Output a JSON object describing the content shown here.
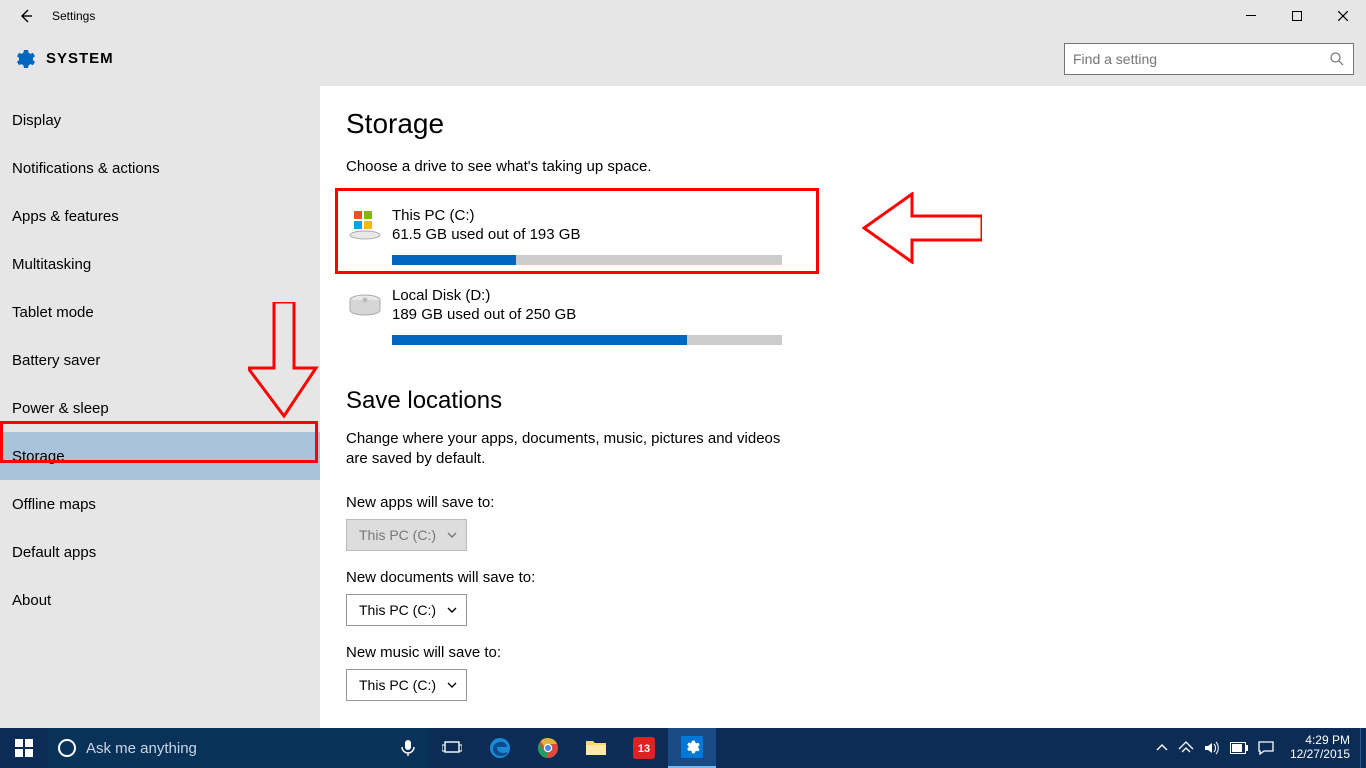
{
  "window": {
    "title": "Settings"
  },
  "header": {
    "section": "SYSTEM",
    "search_placeholder": "Find a setting"
  },
  "sidebar": {
    "items": [
      {
        "label": "Display"
      },
      {
        "label": "Notifications & actions"
      },
      {
        "label": "Apps & features"
      },
      {
        "label": "Multitasking"
      },
      {
        "label": "Tablet mode"
      },
      {
        "label": "Battery saver"
      },
      {
        "label": "Power & sleep"
      },
      {
        "label": "Storage"
      },
      {
        "label": "Offline maps"
      },
      {
        "label": "Default apps"
      },
      {
        "label": "About"
      }
    ],
    "selected_index": 7
  },
  "page": {
    "title": "Storage",
    "subtitle": "Choose a drive to see what's taking up space.",
    "drives": [
      {
        "name": "This PC (C:)",
        "usage": "61.5 GB used out of 193 GB",
        "fill_pct": 31.9
      },
      {
        "name": "Local Disk (D:)",
        "usage": "189 GB used out of 250 GB",
        "fill_pct": 75.6
      }
    ],
    "save_title": "Save locations",
    "save_desc": "Change where your apps, documents, music, pictures and videos are saved by default.",
    "save_groups": [
      {
        "label": "New apps will save to:",
        "value": "This PC (C:)",
        "disabled": true
      },
      {
        "label": "New documents will save to:",
        "value": "This PC (C:)",
        "disabled": false
      },
      {
        "label": "New music will save to:",
        "value": "This PC (C:)",
        "disabled": false
      }
    ]
  },
  "taskbar": {
    "cortana_hint": "Ask me anything",
    "time": "4:29 PM",
    "date": "12/27/2015"
  }
}
